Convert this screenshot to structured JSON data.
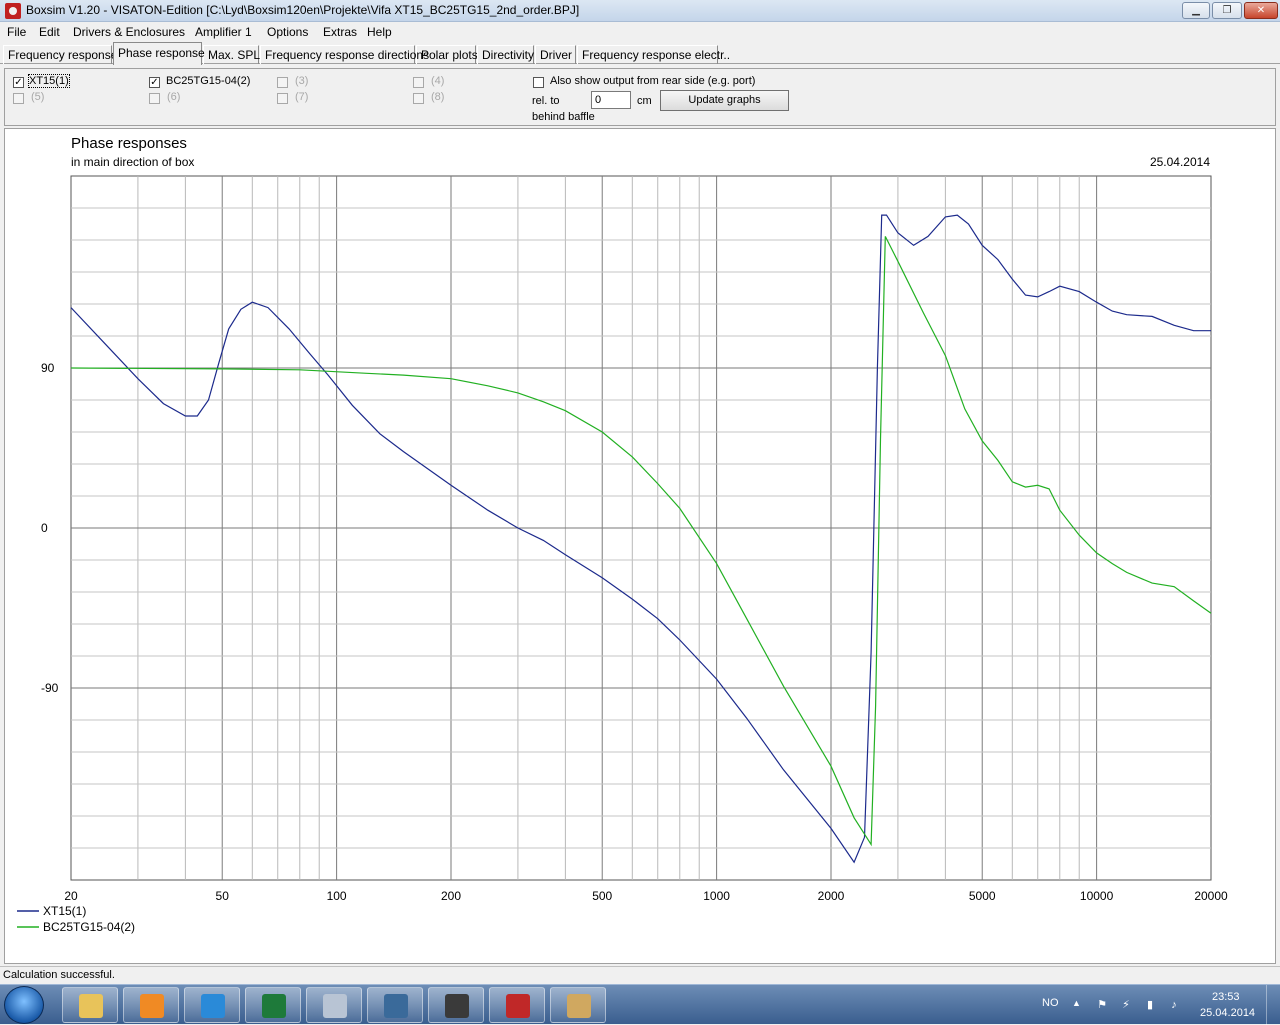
{
  "window": {
    "title": "Boxsim V1.20 - VISATON-Edition [C:\\Lyd\\Boxsim120en\\Projekte\\Vifa XT15_BC25TG15_2nd_order.BPJ]",
    "min_label": "▁",
    "max_label": "❐",
    "close_label": "✕"
  },
  "menu": {
    "items": [
      "File",
      "Edit",
      "Drivers & Enclosures",
      "Amplifier 1",
      "Options",
      "Extras",
      "Help"
    ]
  },
  "tabs": {
    "items": [
      "Frequency response.",
      "Phase response",
      "Max. SPL",
      "Frequency response directions",
      "Polar plots",
      "Directivity",
      "Driver",
      "Frequency response electr.."
    ],
    "active": "Phase response"
  },
  "options": {
    "drivers": [
      {
        "label": "XT15(1)",
        "checked": true,
        "enabled": true
      },
      {
        "label": "BC25TG15-04(2)",
        "checked": true,
        "enabled": true
      },
      {
        "label": "(3)",
        "checked": false,
        "enabled": false
      },
      {
        "label": "(4)",
        "checked": false,
        "enabled": false
      },
      {
        "label": "(5)",
        "checked": false,
        "enabled": false
      },
      {
        "label": "(6)",
        "checked": false,
        "enabled": false
      },
      {
        "label": "(7)",
        "checked": false,
        "enabled": false
      },
      {
        "label": "(8)",
        "checked": false,
        "enabled": false
      }
    ],
    "rear_label": "Also show output from rear side (e.g. port)",
    "rel_label": "rel. to",
    "rel_value": "0",
    "unit_label": "cm",
    "baffle_label": "behind baffle",
    "update_label": "Update graphs"
  },
  "chart_data": {
    "type": "line",
    "title": "Phase responses",
    "subtitle": "in main direction of box",
    "date": "25.04.2014",
    "x_scale": "log",
    "xlim": [
      20,
      20000
    ],
    "ylim": [
      -198,
      198
    ],
    "x_ticks": [
      20,
      50,
      100,
      200,
      500,
      1000,
      2000,
      5000,
      10000,
      20000
    ],
    "y_ticks": [
      90,
      0,
      -90
    ],
    "grid": true,
    "legend_position": "bottom-left",
    "series": [
      {
        "name": "XT15(1)",
        "color": "#1c2a8c",
        "points": [
          [
            20,
            124
          ],
          [
            25,
            102
          ],
          [
            30,
            84
          ],
          [
            35,
            70
          ],
          [
            40,
            63
          ],
          [
            43,
            63
          ],
          [
            46,
            72
          ],
          [
            49,
            93
          ],
          [
            52,
            112
          ],
          [
            56,
            123
          ],
          [
            60,
            127
          ],
          [
            66,
            124
          ],
          [
            75,
            112
          ],
          [
            85,
            98
          ],
          [
            95,
            86
          ],
          [
            110,
            69
          ],
          [
            130,
            53
          ],
          [
            150,
            43
          ],
          [
            200,
            24
          ],
          [
            250,
            10
          ],
          [
            300,
            0
          ],
          [
            350,
            -7
          ],
          [
            400,
            -15
          ],
          [
            500,
            -28
          ],
          [
            600,
            -40
          ],
          [
            700,
            -51
          ],
          [
            800,
            -63
          ],
          [
            1000,
            -85
          ],
          [
            1200,
            -107
          ],
          [
            1500,
            -136
          ],
          [
            2000,
            -169
          ],
          [
            2300,
            -188
          ],
          [
            2450,
            -174
          ],
          [
            2550,
            -70
          ],
          [
            2650,
            90
          ],
          [
            2720,
            176
          ],
          [
            2800,
            176
          ],
          [
            3000,
            166
          ],
          [
            3300,
            159
          ],
          [
            3600,
            164
          ],
          [
            4000,
            175
          ],
          [
            4300,
            176
          ],
          [
            4600,
            171
          ],
          [
            5000,
            159
          ],
          [
            5500,
            151
          ],
          [
            6000,
            140
          ],
          [
            6500,
            131
          ],
          [
            7000,
            130
          ],
          [
            7500,
            133
          ],
          [
            8000,
            136
          ],
          [
            9000,
            133
          ],
          [
            10000,
            127
          ],
          [
            11000,
            122
          ],
          [
            12000,
            120
          ],
          [
            14000,
            119
          ],
          [
            16000,
            114
          ],
          [
            18000,
            111
          ],
          [
            20000,
            111
          ]
        ]
      },
      {
        "name": "BC25TG15-04(2)",
        "color": "#22b022",
        "points": [
          [
            20,
            90
          ],
          [
            50,
            89.5
          ],
          [
            80,
            89
          ],
          [
            120,
            87
          ],
          [
            150,
            86
          ],
          [
            200,
            84
          ],
          [
            250,
            80
          ],
          [
            300,
            76
          ],
          [
            350,
            71
          ],
          [
            400,
            66
          ],
          [
            500,
            54
          ],
          [
            600,
            40
          ],
          [
            700,
            25
          ],
          [
            800,
            11
          ],
          [
            1000,
            -20
          ],
          [
            1200,
            -51
          ],
          [
            1500,
            -89
          ],
          [
            2000,
            -134
          ],
          [
            2300,
            -163
          ],
          [
            2550,
            -178
          ],
          [
            2620,
            -100
          ],
          [
            2700,
            50
          ],
          [
            2780,
            164
          ],
          [
            3000,
            150
          ],
          [
            3500,
            121
          ],
          [
            4000,
            97
          ],
          [
            4500,
            67
          ],
          [
            5000,
            49
          ],
          [
            5500,
            38
          ],
          [
            6000,
            26
          ],
          [
            6500,
            23
          ],
          [
            7000,
            24
          ],
          [
            7500,
            22
          ],
          [
            8000,
            10
          ],
          [
            9000,
            -4
          ],
          [
            10000,
            -14
          ],
          [
            11000,
            -20
          ],
          [
            12000,
            -25
          ],
          [
            14000,
            -31
          ],
          [
            16000,
            -33
          ],
          [
            18000,
            -41
          ],
          [
            20000,
            -48
          ]
        ]
      }
    ]
  },
  "status": {
    "text": "Calculation successful."
  },
  "taskbar": {
    "apps": [
      {
        "icon": "folder-icon",
        "color": "#e8c35a"
      },
      {
        "icon": "media-player-icon",
        "color": "#f08a24"
      },
      {
        "icon": "internet-explorer-icon",
        "color": "#2a8ad8"
      },
      {
        "icon": "excel-icon",
        "color": "#1e7a3a"
      },
      {
        "icon": "calculator-icon",
        "color": "#b8c4d4"
      },
      {
        "icon": "mountain-app-icon",
        "color": "#3a6a9a"
      },
      {
        "icon": "wxsim-icon",
        "color": "#3a3a3a"
      },
      {
        "icon": "boxsim-icon",
        "color": "#c02828"
      },
      {
        "icon": "paint-icon",
        "color": "#d0a860"
      }
    ],
    "language": "NO",
    "time": "23:53",
    "date": "25.04.2014"
  }
}
